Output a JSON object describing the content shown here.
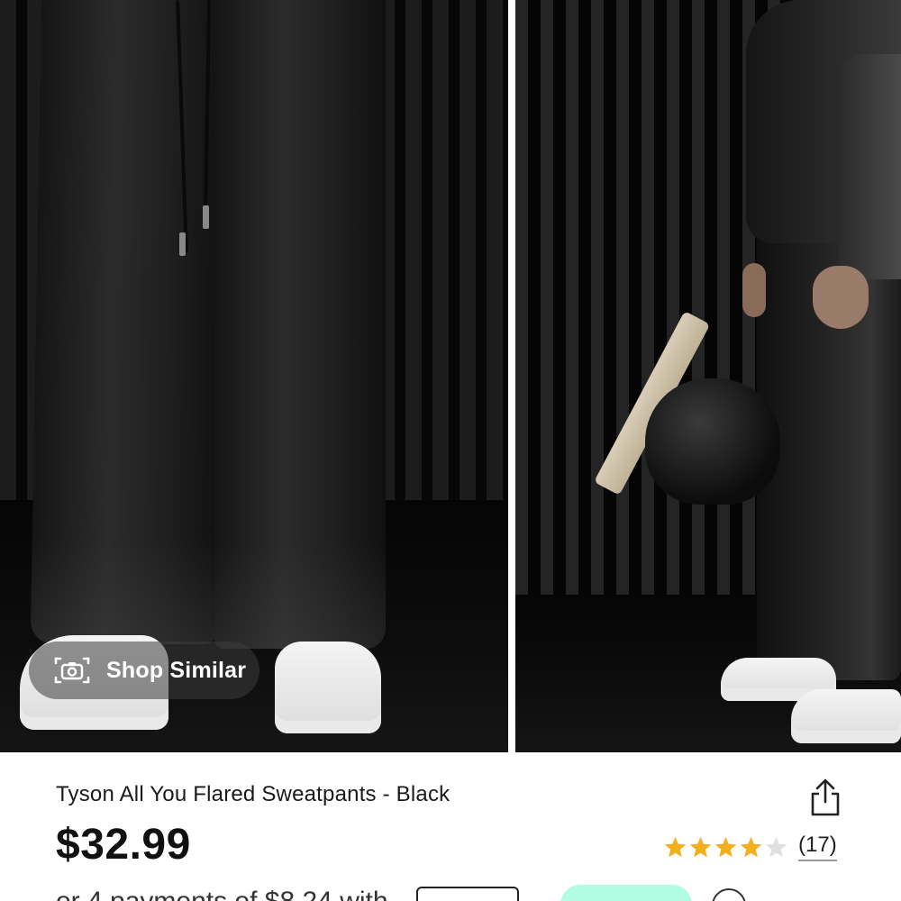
{
  "gallery": {
    "shop_similar_label": "Shop Similar"
  },
  "product": {
    "title": "Tyson All You Flared Sweatpants - Black",
    "price": "$32.99",
    "rating": {
      "value": 4,
      "max": 5,
      "review_count": "(17)"
    }
  },
  "payment": {
    "installment_text": "or 4 payments of $8.24 with"
  },
  "colors": {
    "star_filled": "#f2b01e",
    "star_empty": "#e0e0e0",
    "afterpay_pill": "#b2fce4"
  },
  "icons": {
    "shop_similar": "camera-icon",
    "share": "share-icon",
    "info": "info-icon"
  }
}
